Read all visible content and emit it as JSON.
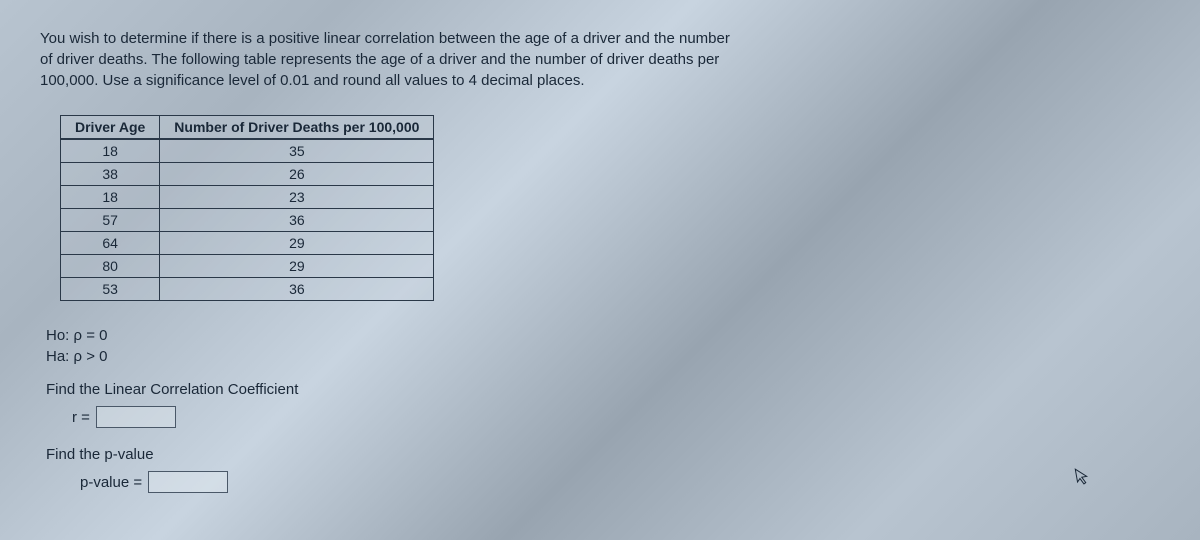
{
  "intro_line1": "You wish to determine if there is a positive linear correlation between the age of a driver and the number",
  "intro_line2": "of driver deaths. The following table represents the age of a driver and the number of driver deaths per",
  "intro_line3": "100,000. Use a significance level of 0.01 and round all values to 4 decimal places.",
  "table": {
    "col1_header": "Driver Age",
    "col2_header": "Number of Driver Deaths per 100,000",
    "rows": [
      {
        "age": "18",
        "deaths": "35"
      },
      {
        "age": "38",
        "deaths": "26"
      },
      {
        "age": "18",
        "deaths": "23"
      },
      {
        "age": "57",
        "deaths": "36"
      },
      {
        "age": "64",
        "deaths": "29"
      },
      {
        "age": "80",
        "deaths": "29"
      },
      {
        "age": "53",
        "deaths": "36"
      }
    ]
  },
  "hypotheses": {
    "ho": "Ho: ρ = 0",
    "ha": "Ha: ρ > 0"
  },
  "corr_label": "Find the Linear Correlation Coefficient",
  "r_label": "r =",
  "pvalue_section_label": "Find the p-value",
  "pvalue_label": "p-value =",
  "chart_data": {
    "type": "table",
    "title": "Driver Age vs Number of Driver Deaths per 100,000",
    "columns": [
      "Driver Age",
      "Number of Driver Deaths per 100,000"
    ],
    "rows": [
      [
        18,
        35
      ],
      [
        38,
        26
      ],
      [
        18,
        23
      ],
      [
        57,
        36
      ],
      [
        64,
        29
      ],
      [
        80,
        29
      ],
      [
        53,
        36
      ]
    ]
  }
}
